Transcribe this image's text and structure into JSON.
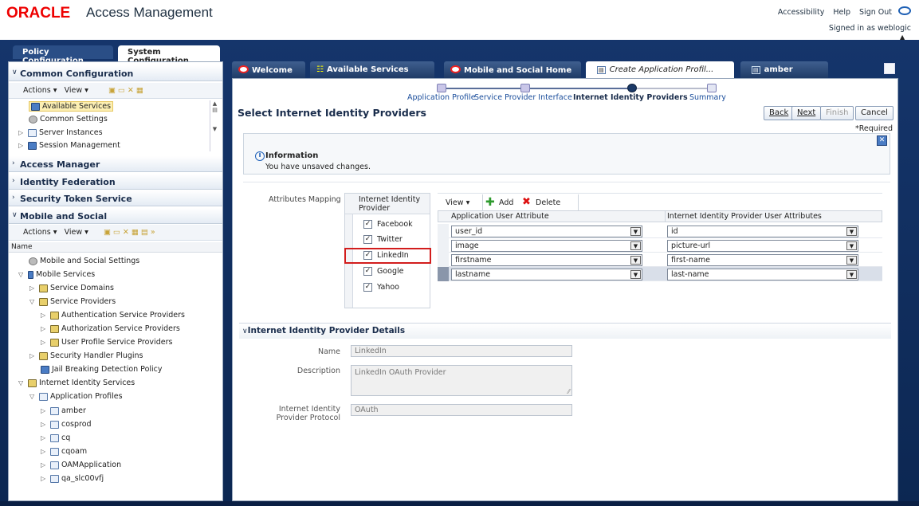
{
  "header": {
    "logo": "ORACLE",
    "title": "Access Management",
    "links": [
      "Accessibility",
      "Help",
      "Sign Out"
    ],
    "signed_in": "Signed in as weblogic"
  },
  "main_tabs": [
    "Policy Configuration",
    "System Configuration"
  ],
  "left": {
    "common_config": "Common Configuration",
    "toolbar_actions": "Actions ▾",
    "toolbar_view": "View ▾",
    "top_tree": [
      "Available Services",
      "Common Settings",
      "Server Instances",
      "Session Management"
    ],
    "access_manager": "Access Manager",
    "identity_federation": "Identity Federation",
    "security_token_service": "Security Token Service",
    "mobile_social": "Mobile and Social",
    "name_col": "Name",
    "tree": [
      "Mobile and Social Settings",
      "Mobile Services",
      "Service Domains",
      "Service Providers",
      "Authentication Service Providers",
      "Authorization Service Providers",
      "User Profile Service Providers",
      "Security Handler Plugins",
      "Jail Breaking Detection Policy",
      "Internet Identity Services",
      "Application Profiles",
      "amber",
      "cosprod",
      "cq",
      "cqoam",
      "OAMApplication",
      "qa_slc00vfj"
    ]
  },
  "right_tabs": [
    "Welcome",
    "Available Services",
    "Mobile and Social Home",
    "Create Application Profil...",
    "amber"
  ],
  "train": [
    "Application Profile",
    "Service Provider Interface",
    "Internet Identity Providers",
    "Summary"
  ],
  "page_title": "Select Internet Identity Providers",
  "buttons": {
    "back": "Back",
    "next": "Next",
    "finish": "Finish",
    "cancel": "Cancel"
  },
  "required": "*Required",
  "info": {
    "title": "Information",
    "message": "You have unsaved changes."
  },
  "attributes_mapping_label": "Attributes Mapping",
  "idp_header": "Internet Identity Provider",
  "idps": [
    "Facebook",
    "Twitter",
    "LinkedIn",
    "Google",
    "Yahoo"
  ],
  "mapping_toolbar": {
    "view": "View ▾",
    "add": "Add",
    "delete": "Delete"
  },
  "mapping_columns": [
    "Application User Attribute",
    "Internet Identity Provider User Attributes"
  ],
  "mapping_rows": [
    {
      "app": "user_id",
      "idp": "id"
    },
    {
      "app": "image",
      "idp": "picture-url"
    },
    {
      "app": "firstname",
      "idp": "first-name"
    },
    {
      "app": "lastname",
      "idp": "last-name"
    }
  ],
  "details": {
    "title": "Internet Identity Provider Details",
    "name_label": "Name",
    "name_value": "LinkedIn",
    "desc_label": "Description",
    "desc_value": "LinkedIn OAuth Provider",
    "protocol_label": "Internet Identity Provider Protocol",
    "protocol_value": "OAuth"
  },
  "colors": {
    "brand": "#e00000",
    "band": "#15356b",
    "highlight": "#d21d1d",
    "link": "#1a4d9b"
  }
}
